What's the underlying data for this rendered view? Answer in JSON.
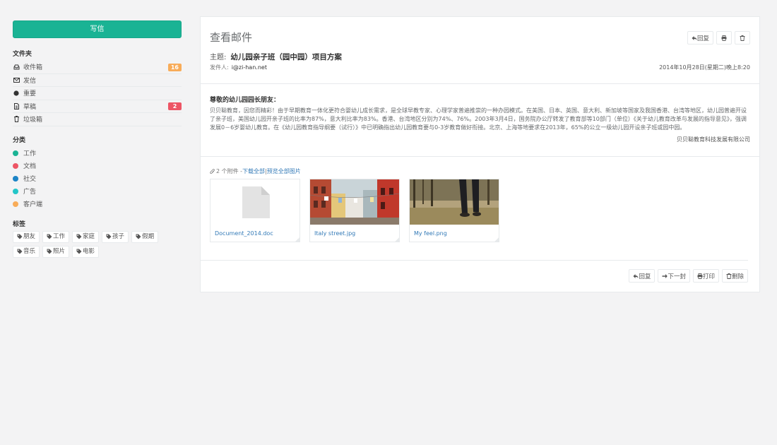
{
  "sidebar": {
    "compose_label": "写信",
    "folders_heading": "文件夹",
    "folders": [
      {
        "label": "收件箱",
        "icon": "inbox-icon",
        "badge": "16",
        "badge_color": "#f8ac59"
      },
      {
        "label": "发信",
        "icon": "envelope-icon",
        "badge": "",
        "badge_color": ""
      },
      {
        "label": "重要",
        "icon": "certificate-icon",
        "badge": "",
        "badge_color": ""
      },
      {
        "label": "草稿",
        "icon": "file-text-icon",
        "badge": "2",
        "badge_color": "#ed5565"
      },
      {
        "label": "垃圾箱",
        "icon": "trash-icon",
        "badge": "",
        "badge_color": ""
      }
    ],
    "categories_heading": "分类",
    "categories": [
      {
        "label": "工作",
        "color": "#1ab394"
      },
      {
        "label": "文档",
        "color": "#ed5565"
      },
      {
        "label": "社交",
        "color": "#1c84c6"
      },
      {
        "label": "广告",
        "color": "#23c6c8"
      },
      {
        "label": "客户端",
        "color": "#f8ac59"
      }
    ],
    "tags_heading": "标签",
    "tags": [
      "朋友",
      "工作",
      "家庭",
      "孩子",
      "假期",
      "音乐",
      "照片",
      "电影"
    ]
  },
  "mail": {
    "panel_title": "查看邮件",
    "reply_label": "回复",
    "subject_label": "主题:",
    "subject": "幼儿园亲子班（园中园）项目方案",
    "sender_label": "发件人:",
    "sender": "i@zi-han.net",
    "date": "2014年10月28日(星期二)晚上8:20",
    "greeting": "尊敬的幼儿园园长朋友：",
    "body": "贝贝聪教育，因您而精彩！由于早期教育一体化更符合婴幼儿成长需求，是全球早教专家、心理学家普遍推崇的一种办园模式。在美国、日本、英国、意大利、新加坡等国家及我国香港、台湾等地区，幼儿园普遍开设了亲子班，美国幼儿园开亲子班的比率为87%，意大利比率为83%。香港、台湾地区分别为74%、76%。2003年3月4日，国务院办公厅转发了教育部等10部门（单位）《关于幼儿教育改革与发展的指导意见》，强调发展0－6岁婴幼儿教育。在《幼儿园教育指导纲要（试行）》中已明确指出幼儿园教育要与0-3岁教育做好衔接。北京、上海等地要求在2013年，65%的公立一级幼儿园开设亲子班或园中园。",
    "signature": "贝贝聪教育科技发展有限公司",
    "attachments_count": "2 个附件 - ",
    "download_all": "下载全部",
    "separator": " | ",
    "view_all_images": "预览全部图片",
    "attachments": [
      {
        "name": "Document_2014.doc",
        "type": "doc"
      },
      {
        "name": "Italy street.jpg",
        "type": "image-street"
      },
      {
        "name": "My feel.png",
        "type": "image-feet"
      }
    ],
    "bottom_buttons": {
      "reply": "回复",
      "next": "下一封",
      "print": "打印",
      "delete": "删除"
    }
  }
}
